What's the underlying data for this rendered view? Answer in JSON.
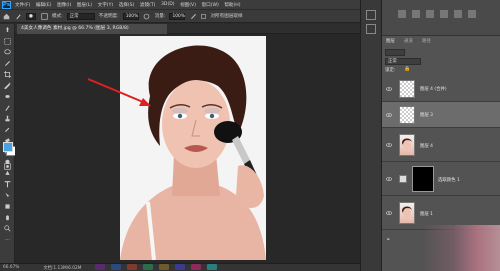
{
  "app": {
    "logo": "Ps"
  },
  "menu": [
    "文件(F)",
    "编辑(E)",
    "图像(I)",
    "图层(L)",
    "文字(Y)",
    "选择(S)",
    "滤镜(T)",
    "3D(D)",
    "视图(V)",
    "窗口(W)",
    "帮助(H)"
  ],
  "options": {
    "mode_label": "模式:",
    "mode_value": "正常",
    "opacity_label": "不透明度:",
    "opacity_value": "100%",
    "flow_label": "流量:",
    "flow_value": "100%",
    "sample_all_label": "对所有图层取样"
  },
  "document": {
    "tab_title": "4美女人像调色 素材.jpg @ 66.7% (图层 3, RGB/8)",
    "zoom": "66.67%",
    "doc_info": "文档:1.13M/6.02M"
  },
  "panel": {
    "tabs": [
      "图层",
      "通道",
      "路径"
    ],
    "blend_mode": "正常",
    "lock_label": "锁定:",
    "layers": [
      {
        "name": "图层 4 (合并)",
        "thumb": "transparent"
      },
      {
        "name": "图层 3",
        "thumb": "transparent"
      },
      {
        "name": "图层 4",
        "thumb": "portrait"
      },
      {
        "name": "选取颜色 1",
        "thumb": "adjustment"
      },
      {
        "name": "图层 1",
        "thumb": "portrait"
      }
    ]
  },
  "colors": {
    "foreground": "#4aa3e0",
    "background": "#ffffff",
    "accent": "#31a8ff",
    "arrow": "#e02020"
  },
  "icons": [
    "home-icon",
    "brush-tool-icon",
    "eye-icon",
    "lock-icon"
  ]
}
